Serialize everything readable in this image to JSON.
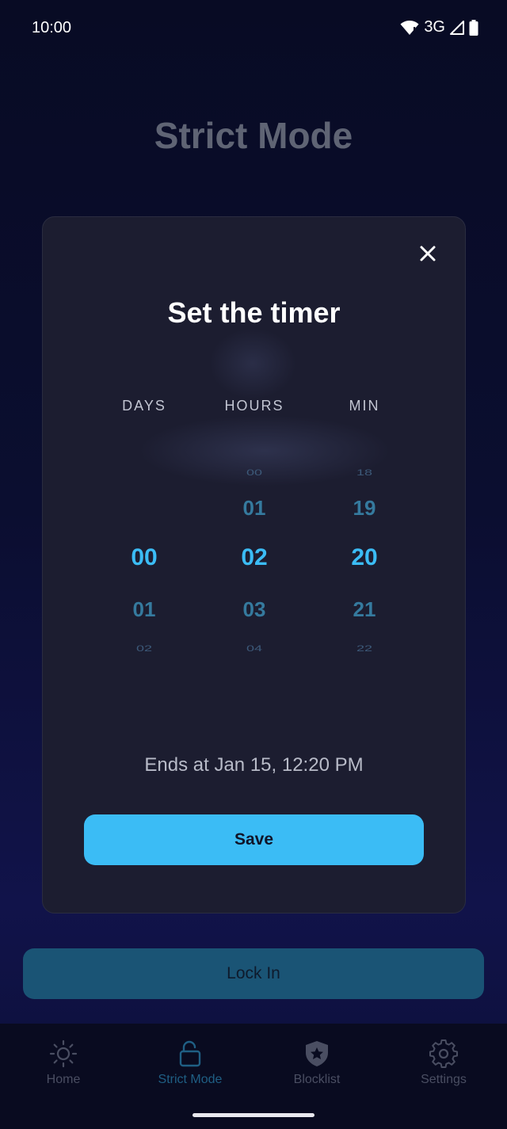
{
  "status_bar": {
    "time": "10:00",
    "network": "3G"
  },
  "page": {
    "title": "Strict Mode"
  },
  "timer_dialog": {
    "title": "Set the timer",
    "columns": [
      {
        "header": "DAYS",
        "values": [
          "",
          "",
          "00",
          "01",
          "02"
        ]
      },
      {
        "header": "HOURS",
        "values": [
          "00",
          "01",
          "02",
          "03",
          "04"
        ]
      },
      {
        "header": "MIN",
        "values": [
          "18",
          "19",
          "20",
          "21",
          "22"
        ]
      }
    ],
    "ends_at": "Ends at Jan 15, 12:20 PM",
    "save_label": "Save"
  },
  "lock_in_label": "Lock In",
  "bottom_nav": {
    "items": [
      {
        "label": "Home",
        "icon": "sun-icon"
      },
      {
        "label": "Strict Mode",
        "icon": "unlock-icon"
      },
      {
        "label": "Blocklist",
        "icon": "shield-star-icon"
      },
      {
        "label": "Settings",
        "icon": "gear-icon"
      }
    ]
  },
  "colors": {
    "accent": "#3bbcf5",
    "background": "#0b0e30",
    "dialog": "#1c1d30",
    "lock_button": "#1a5475"
  }
}
